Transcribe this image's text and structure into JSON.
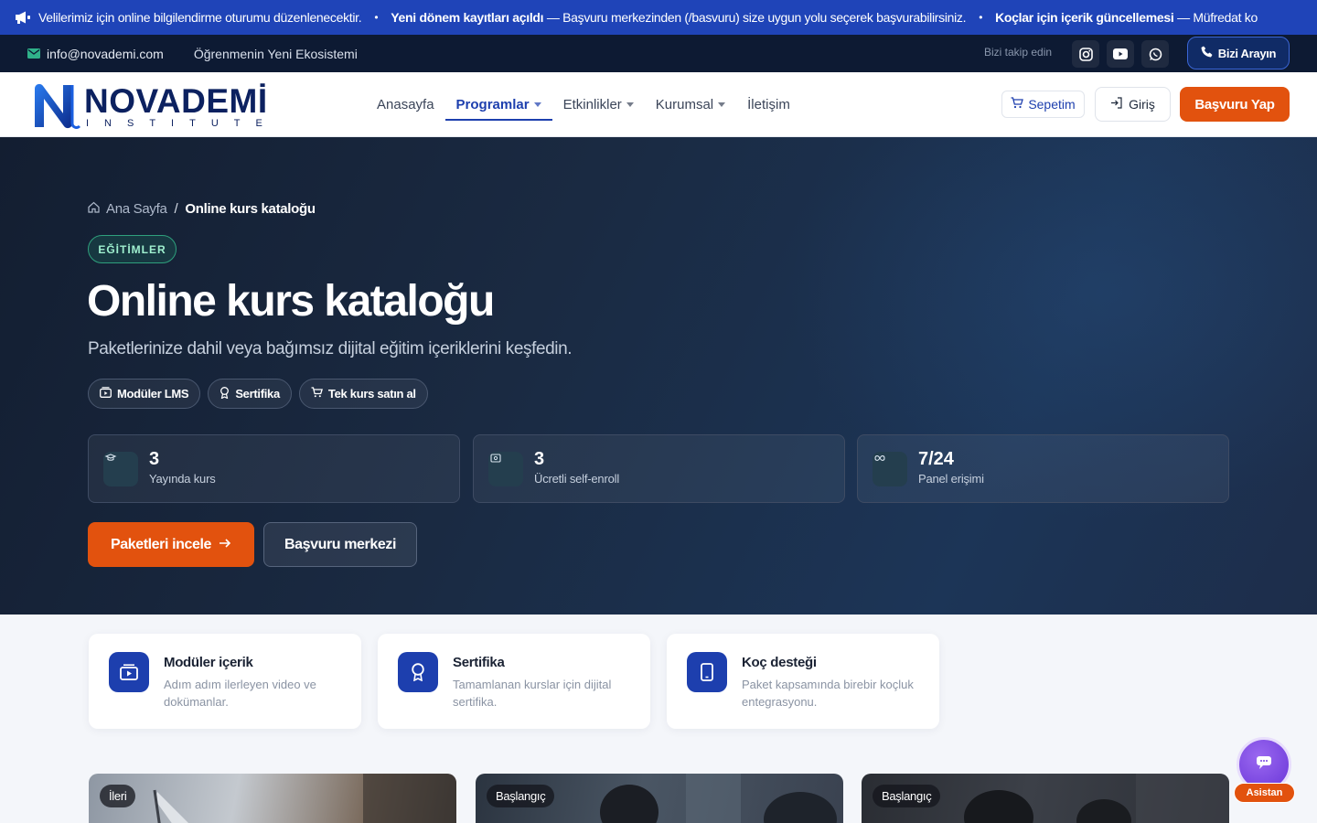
{
  "ticker": {
    "items": [
      {
        "bold": "",
        "text": "Velilerimiz için online bilgilendirme oturumu düzenlenecektir."
      },
      {
        "bold": "Yeni dönem kayıtları açıldı",
        "text": " — Başvuru merkezinden (/basvuru) size uygun yolu seçerek başvurabilirsiniz."
      },
      {
        "bold": "Koçlar için içerik güncellemesi",
        "text": " — Müfredat ko"
      }
    ]
  },
  "topbar": {
    "email": "info@novademi.com",
    "tagline": "Öğrenmenin Yeni Ekosistemi",
    "follow_label": "Bizi takip edin",
    "call_label": "Bizi Arayın"
  },
  "header": {
    "logo_word": "NOVADEMİ",
    "logo_sub": "INSTITUTE",
    "menu": [
      {
        "label": "Anasayfa",
        "dropdown": false,
        "active": false
      },
      {
        "label": "Programlar",
        "dropdown": true,
        "active": true
      },
      {
        "label": "Etkinlikler",
        "dropdown": true,
        "active": false
      },
      {
        "label": "Kurumsal",
        "dropdown": true,
        "active": false
      },
      {
        "label": "İletişim",
        "dropdown": false,
        "active": false
      }
    ],
    "cart_label": "Sepetim",
    "login_label": "Giriş",
    "apply_label": "Başvuru Yap"
  },
  "hero": {
    "breadcrumb_home": "Ana Sayfa",
    "breadcrumb_sep": "/",
    "breadcrumb_current": "Online kurs kataloğu",
    "eyebrow": "EĞİTİMLER",
    "title": "Online kurs kataloğu",
    "subtitle": "Paketlerinize dahil veya bağımsız dijital eğitim içeriklerini keşfedin.",
    "chips": [
      "Modüler LMS",
      "Sertifika",
      "Tek kurs satın al"
    ],
    "stats": [
      {
        "value": "3",
        "label": "Yayında kurs"
      },
      {
        "value": "3",
        "label": "Ücretli self-enroll"
      },
      {
        "value": "7/24",
        "label": "Panel erişimi"
      }
    ],
    "primary_cta": "Paketleri incele",
    "secondary_cta": "Başvuru merkezi"
  },
  "features": [
    {
      "title": "Modüler içerik",
      "desc": "Adım adım ilerleyen video ve dokümanlar."
    },
    {
      "title": "Sertifika",
      "desc": "Tamamlanan kurslar için dijital sertifika."
    },
    {
      "title": "Koç desteği",
      "desc": "Paket kapsamında birebir koçluk entegrasyonu."
    }
  ],
  "courses": [
    {
      "level": "İleri"
    },
    {
      "level": "Başlangıç"
    },
    {
      "level": "Başlangıç"
    }
  ],
  "assistant": {
    "label": "Asistan"
  },
  "colors": {
    "brand_blue": "#1d3fae",
    "accent_orange": "#e2520e",
    "ticker_bg": "#1f44b8",
    "topbar_bg": "#0d1a33",
    "hero_bg": "#1a2a42"
  }
}
